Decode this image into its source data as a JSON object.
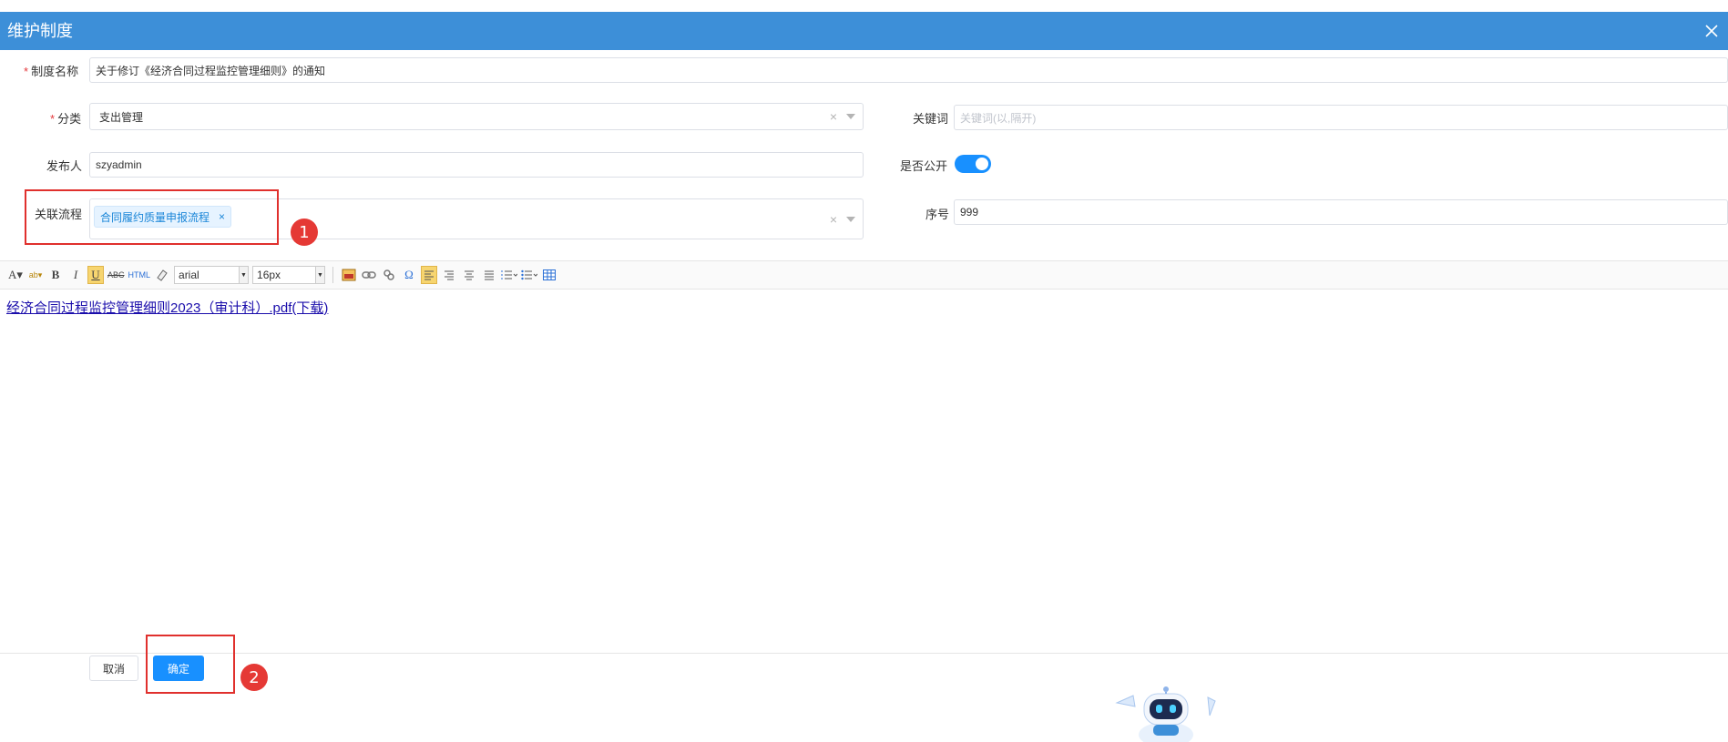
{
  "dialog": {
    "title": "维护制度"
  },
  "form": {
    "name": {
      "label": "制度名称",
      "value": "关于修订《经济合同过程监控管理细则》的通知"
    },
    "category": {
      "label": "分类",
      "value": "支出管理"
    },
    "keywords": {
      "label": "关键词",
      "placeholder": "关键词(以,隔开)"
    },
    "publisher": {
      "label": "发布人",
      "value": "szyadmin"
    },
    "is_public": {
      "label": "是否公开",
      "on": true
    },
    "process": {
      "label": "关联流程",
      "tag": "合同履约质量申报流程",
      "tag_close": "×"
    },
    "order": {
      "label": "序号",
      "value": "999"
    }
  },
  "editor": {
    "font_family": "arial",
    "font_size": "16px",
    "content_link": "经济合同过程监控管理细则2023（审计科）.pdf(下载)"
  },
  "buttons": {
    "cancel": "取消",
    "confirm": "确定"
  },
  "annotations": {
    "badge1": "1",
    "badge2": "2"
  },
  "colors": {
    "header": "#3d8fd8",
    "primary": "#1890ff",
    "annotation": "#e0302d"
  }
}
